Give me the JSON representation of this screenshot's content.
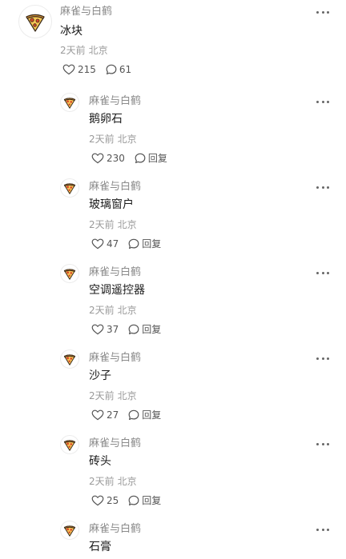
{
  "comments": [
    {
      "author": "麻雀与白鹤",
      "text": "冰块",
      "time": "2天前",
      "location": "北京",
      "likes": "215",
      "replies": "61"
    },
    {
      "author": "麻雀与白鹤",
      "text": "鹅卵石",
      "time": "2天前",
      "location": "北京",
      "likes": "230",
      "reply_label": "回复"
    },
    {
      "author": "麻雀与白鹤",
      "text": "玻璃窗户",
      "time": "2天前",
      "location": "北京",
      "likes": "47",
      "reply_label": "回复"
    },
    {
      "author": "麻雀与白鹤",
      "text": "空调遥控器",
      "time": "2天前",
      "location": "北京",
      "likes": "37",
      "reply_label": "回复"
    },
    {
      "author": "麻雀与白鹤",
      "text": "沙子",
      "time": "2天前",
      "location": "北京",
      "likes": "27",
      "reply_label": "回复"
    },
    {
      "author": "麻雀与白鹤",
      "text": "砖头",
      "time": "2天前",
      "location": "北京",
      "likes": "25",
      "reply_label": "回复"
    },
    {
      "author": "麻雀与白鹤",
      "text": "石膏"
    }
  ],
  "icons": {
    "avatar": "pizza-icon",
    "like": "heart-outline-icon",
    "comment": "speech-bubble-icon",
    "more": "more-dots-icon"
  },
  "colors": {
    "author": "#8a8a8a",
    "text": "#1a1a1a",
    "meta": "#9a9a9a",
    "pizza_crust": "#e39a3b",
    "pizza_cheese": "#f6c655",
    "pizza_pepperoni": "#d9482b"
  }
}
